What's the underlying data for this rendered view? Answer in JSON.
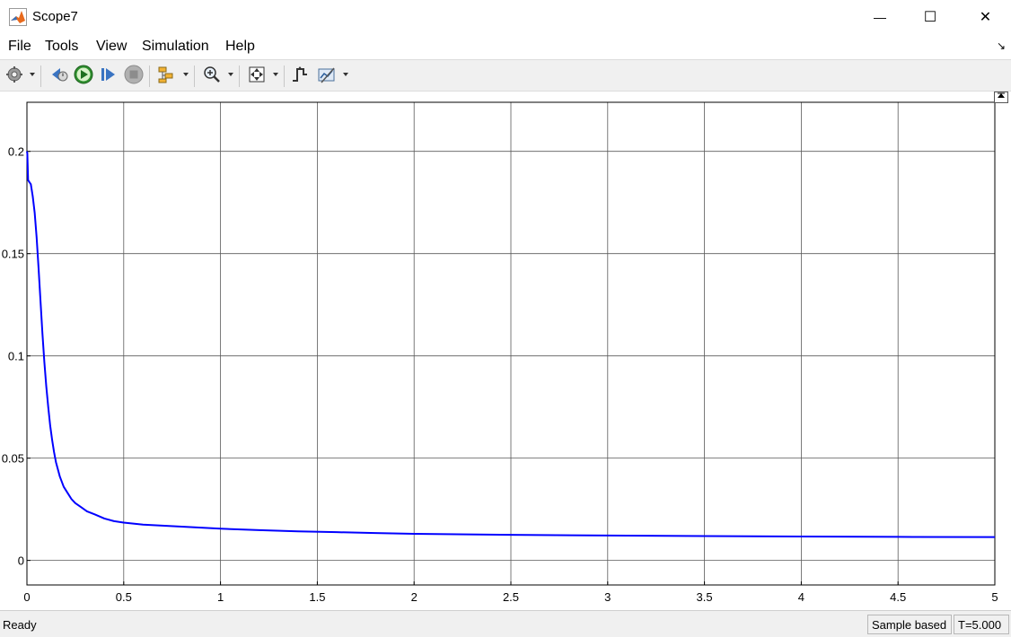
{
  "window": {
    "title": "Scope7",
    "minimize_glyph": "—",
    "maximize_glyph": "☐",
    "close_glyph": "✕"
  },
  "menu": {
    "items": [
      "File",
      "Tools",
      "View",
      "Simulation",
      "Help"
    ],
    "overflow_glyph": "↘"
  },
  "toolbar": {
    "icons": [
      "settings-icon",
      "step-back-icon",
      "run-icon",
      "step-forward-icon",
      "stop-icon",
      "signal-selector-icon",
      "zoom-icon",
      "autoscale-icon",
      "triggers-icon",
      "measurements-icon"
    ]
  },
  "status": {
    "ready": "Ready",
    "sample_mode": "Sample based",
    "time": "T=5.000"
  },
  "colors": {
    "trace": "#0000ff",
    "grid": "#5a5a5a",
    "toolbar_bg": "#f0f0f0"
  },
  "chart_data": {
    "type": "line",
    "title": "",
    "xlabel": "",
    "ylabel": "",
    "xlim": [
      0,
      5
    ],
    "ylim": [
      -0.012,
      0.224
    ],
    "grid": true,
    "x_ticks": [
      0,
      0.5,
      1,
      1.5,
      2,
      2.5,
      3,
      3.5,
      4,
      4.5,
      5
    ],
    "x_tick_labels": [
      "0",
      "0.5",
      "1",
      "1.5",
      "2",
      "2.5",
      "3",
      "3.5",
      "4",
      "4.5",
      "5"
    ],
    "y_ticks": [
      0,
      0.05,
      0.1,
      0.15,
      0.2
    ],
    "y_tick_labels": [
      "0",
      "0.05",
      "0.1",
      "0.15",
      "0.2"
    ],
    "series": [
      {
        "color": "#0000ff",
        "x": [
          0,
          0.002,
          0.006,
          0.012,
          0.02,
          0.03,
          0.04,
          0.05,
          0.06,
          0.07,
          0.08,
          0.09,
          0.1,
          0.11,
          0.12,
          0.13,
          0.14,
          0.15,
          0.17,
          0.19,
          0.21,
          0.23,
          0.25,
          0.28,
          0.31,
          0.35,
          0.4,
          0.45,
          0.5,
          0.6,
          0.7,
          0.8,
          0.9,
          1.0,
          1.2,
          1.4,
          1.6,
          1.8,
          2.0,
          2.5,
          3.0,
          3.5,
          4.0,
          4.5,
          5.0
        ],
        "y": [
          0.2,
          0.199,
          0.186,
          0.185,
          0.184,
          0.178,
          0.17,
          0.158,
          0.143,
          0.127,
          0.111,
          0.097,
          0.085,
          0.075,
          0.066,
          0.059,
          0.053,
          0.048,
          0.041,
          0.036,
          0.033,
          0.03,
          0.028,
          0.026,
          0.024,
          0.0225,
          0.0205,
          0.0192,
          0.0185,
          0.0175,
          0.017,
          0.0165,
          0.016,
          0.0155,
          0.0148,
          0.0142,
          0.0138,
          0.0134,
          0.013,
          0.0125,
          0.0122,
          0.0119,
          0.0117,
          0.0115,
          0.0114
        ]
      }
    ]
  }
}
